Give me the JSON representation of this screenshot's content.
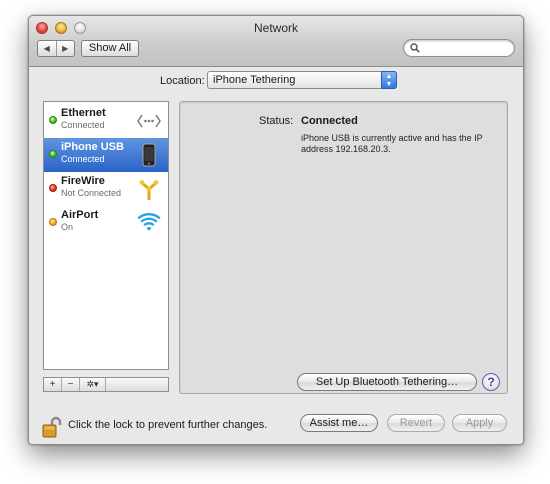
{
  "window": {
    "title": "Network"
  },
  "toolbar": {
    "back_label": "◀",
    "forward_label": "▶",
    "show_all_label": "Show All",
    "search_placeholder": ""
  },
  "location": {
    "label": "Location:",
    "value": "iPhone Tethering"
  },
  "services": [
    {
      "name": "Ethernet",
      "status": "Connected",
      "indicator": "green",
      "icon": "ethernet-icon",
      "selected": false
    },
    {
      "name": "iPhone USB",
      "status": "Connected",
      "indicator": "green",
      "icon": "iphone-icon",
      "selected": true
    },
    {
      "name": "FireWire",
      "status": "Not Connected",
      "indicator": "red",
      "icon": "firewire-icon",
      "selected": false
    },
    {
      "name": "AirPort",
      "status": "On",
      "indicator": "amber",
      "icon": "wifi-icon",
      "selected": false
    }
  ],
  "sidebar_tools": {
    "add": "+",
    "remove": "−",
    "action": "✲▾"
  },
  "detail": {
    "status_label": "Status:",
    "status_value": "Connected",
    "status_description": "iPhone USB is currently active and has the IP address 192.168.20.3.",
    "bluetooth_button": "Set Up Bluetooth Tethering…",
    "help_label": "?"
  },
  "footer": {
    "lock_text": "Click the lock to prevent further changes.",
    "assist_button": "Assist me…",
    "revert_button": "Revert",
    "apply_button": "Apply"
  },
  "colors": {
    "selection": "#2a63c8",
    "connected": "#38b41e",
    "not_connected": "#e22c1c",
    "on": "#f2a11e"
  }
}
